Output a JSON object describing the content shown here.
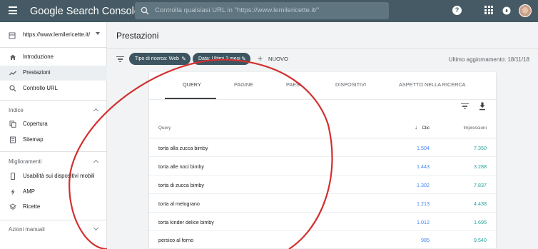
{
  "header": {
    "app_title": "Google Search Console",
    "search_placeholder": "Controlla qualsiasi URL in \"https://www.lemilericette.it/\"",
    "help_label": "?"
  },
  "sidebar": {
    "property": "https://www.lemilericette.it/",
    "items": [
      {
        "label": "Introduzione",
        "icon": "home-icon"
      },
      {
        "label": "Prestazioni",
        "icon": "trending-icon",
        "active": true
      },
      {
        "label": "Controllo URL",
        "icon": "search-icon"
      }
    ],
    "sections": [
      {
        "title": "Indice",
        "items": [
          {
            "label": "Copertura",
            "icon": "copy-icon"
          },
          {
            "label": "Sitemap",
            "icon": "sitemap-icon"
          }
        ]
      },
      {
        "title": "Miglioramenti",
        "items": [
          {
            "label": "Usabilità sui dispositivi mobili",
            "icon": "phone-icon"
          },
          {
            "label": "AMP",
            "icon": "bolt-icon"
          },
          {
            "label": "Ricette",
            "icon": "layers-icon"
          }
        ]
      },
      {
        "title": "Azioni manuali",
        "items": []
      }
    ]
  },
  "main": {
    "page_title": "Prestazioni",
    "chips": [
      {
        "label": "Tipo di ricerca: Web"
      },
      {
        "label": "Data: Ultimi 3 mesi"
      }
    ],
    "new_label": "NUOVO",
    "last_update": "Ultimo aggiornamento: 18/11/18"
  },
  "table": {
    "tabs": [
      "QUERY",
      "PAGINE",
      "PAESI",
      "DISPOSITIVI",
      "ASPETTO NELLA RICERCA"
    ],
    "active_tab": "QUERY",
    "columns": {
      "query": "Query",
      "clicks": "Clic",
      "impressions": "Impressioni"
    },
    "rows": [
      {
        "query": "torta alla zucca bimby",
        "clicks": "1.504",
        "impressions": "7.350"
      },
      {
        "query": "torta alle noci bimby",
        "clicks": "1.443",
        "impressions": "3.288"
      },
      {
        "query": "torta di zucca bimby",
        "clicks": "1.302",
        "impressions": "7.837"
      },
      {
        "query": "torta al melograno",
        "clicks": "1.213",
        "impressions": "4.438"
      },
      {
        "query": "torta kinder delice bimby",
        "clicks": "1.012",
        "impressions": "1.695"
      },
      {
        "query": "persico al forno",
        "clicks": "985",
        "impressions": "9.540"
      }
    ]
  },
  "colors": {
    "topbar": "#455a64",
    "chip": "#3d5560",
    "clicks": "#4285f4",
    "impressions": "#26a69a",
    "annotation_circle": "#d32f2f"
  }
}
